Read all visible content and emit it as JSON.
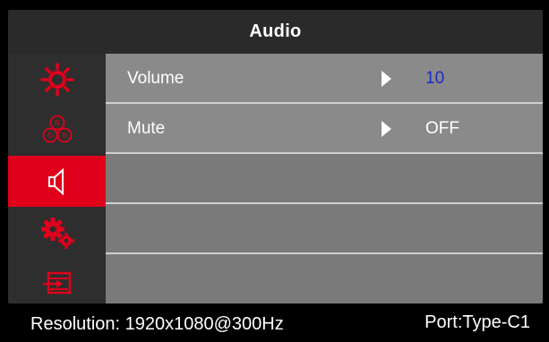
{
  "title": "Audio",
  "sidebar": {
    "items": [
      {
        "icon": "brightness-icon",
        "active": false
      },
      {
        "icon": "color-rgb-icon",
        "active": false
      },
      {
        "icon": "speaker-icon",
        "active": true
      },
      {
        "icon": "settings-gears-icon",
        "active": false
      },
      {
        "icon": "input-source-icon",
        "active": false
      }
    ]
  },
  "rows": [
    {
      "label": "Volume",
      "value": "10"
    },
    {
      "label": "Mute",
      "value": "OFF"
    }
  ],
  "status": {
    "resolution": "Resolution: 1920x1080@300Hz",
    "port": "Port:Type-C1"
  },
  "colors": {
    "accent": "#e0001b",
    "value_blue": "#1a2cc8"
  }
}
